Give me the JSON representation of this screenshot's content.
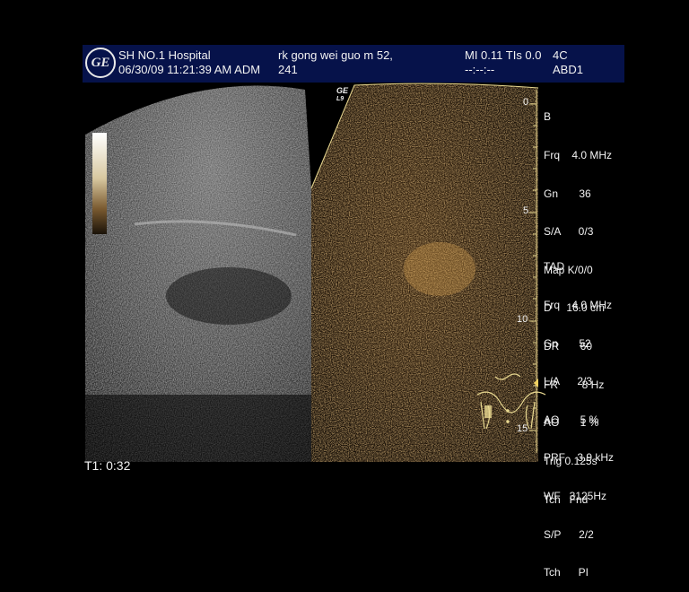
{
  "header": {
    "logo": "GE",
    "hospital": "SH NO.1 Hospital",
    "datetime": "06/30/09 11:21:39 AM ADM",
    "patient": "rk  gong wei guo m 52,",
    "patient_id": "241",
    "mi_tis": "MI 0.11 TIs 0.0",
    "probe": "4C",
    "timer_placeholder": "--:--:--",
    "preset": "ABD1"
  },
  "right_panel": {
    "ge_mark": "GE",
    "probe_mark": "L9"
  },
  "depth_marks": {
    "d0": "0",
    "d5": "5",
    "d10": "10",
    "d15": "15"
  },
  "params_b": {
    "mode": "B",
    "frq": "Frq    4.0 MHz",
    "gn": "Gn       36",
    "sa": "S/A      0/3",
    "map": "Map K/0/0",
    "d": "D     16.0 cm",
    "dr": "DR       60",
    "fr": "FR        8 Hz",
    "ao": "AO       1 %",
    "trig": "Trig 0.125s",
    "tch": "Tch   Fnd"
  },
  "params_tad": {
    "mode": "TAD",
    "frq": "Frq    4.0 MHz",
    "gn": "Gn       52",
    "la": "L/A      2/3",
    "ao": "AO       5 %",
    "prf": "PRF    3.9 kHz",
    "wf": "WF   3125Hz",
    "sp": "S/P      2/2",
    "tch": "Tch      PI"
  },
  "footer": {
    "timer": "T1: 0:32"
  },
  "colors": {
    "header_bg": "#06124a",
    "contrast_tint": "#c8903a",
    "scale_line": "#e8d890"
  }
}
